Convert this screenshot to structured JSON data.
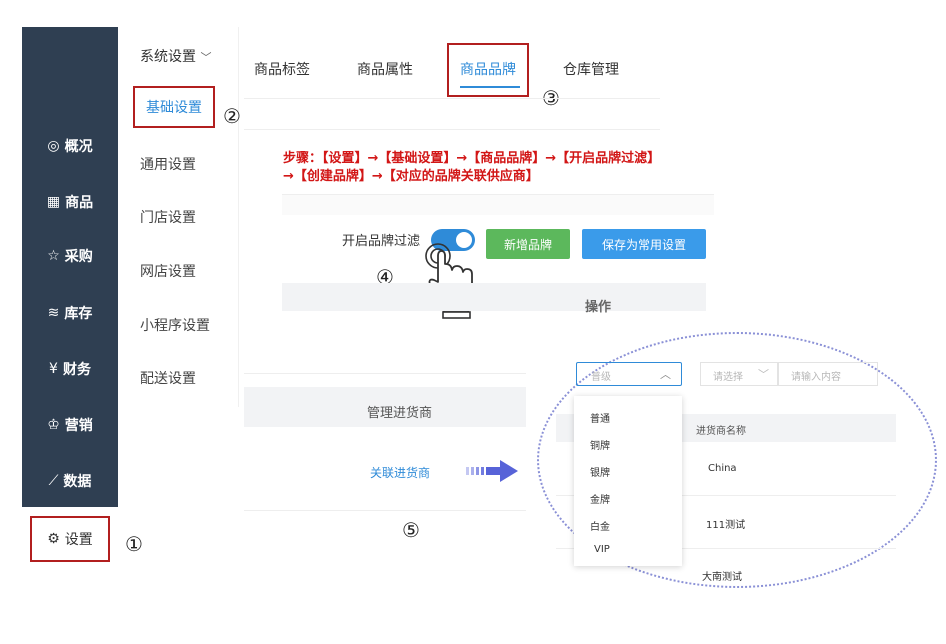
{
  "sidebar": {
    "items": [
      {
        "icon": "compass-icon",
        "glyph": "◎",
        "label": "概况"
      },
      {
        "icon": "grid-icon",
        "glyph": "▦",
        "label": "商品"
      },
      {
        "icon": "cart-icon",
        "glyph": "☆",
        "label": "采购"
      },
      {
        "icon": "layers-icon",
        "glyph": "≋",
        "label": "库存"
      },
      {
        "icon": "yen-icon",
        "glyph": "¥",
        "label": "财务"
      },
      {
        "icon": "crown-icon",
        "glyph": "♔",
        "label": "营销"
      },
      {
        "icon": "chart-icon",
        "glyph": "⟋",
        "label": "数据"
      }
    ],
    "settings": {
      "glyph": "⚙",
      "label": "设置"
    }
  },
  "submenu": {
    "header": "系统设置",
    "items": [
      "基础设置",
      "通用设置",
      "门店设置",
      "网店设置",
      "小程序设置",
      "配送设置"
    ]
  },
  "tabs": [
    "商品标签",
    "商品属性",
    "商品品牌",
    "仓库管理"
  ],
  "steps": {
    "line1": "步骤：【设置】→【基础设置】→【商品品牌】→【开启品牌过滤】",
    "line2": "→【创建品牌】→【对应的品牌关联供应商】"
  },
  "markers": {
    "m1": "①",
    "m2": "②",
    "m3": "③",
    "m4": "④",
    "m5": "⑤"
  },
  "brand_filter": {
    "label": "开启品牌过滤",
    "enabled": true
  },
  "buttons": {
    "new_brand": "新增品牌",
    "save_default": "保存为常用设置"
  },
  "table": {
    "operation_header": "操作",
    "supplier_header": "管理进货商",
    "link_supplier": "关联进货商"
  },
  "zoom_panel": {
    "select_text": "普级",
    "select_placeholder": "请选择",
    "input_placeholder": "请输入内容",
    "dropdown_options": [
      "普通",
      "铜牌",
      "银牌",
      "金牌",
      "白金",
      "VIP"
    ],
    "column_header": "进货商名称",
    "rows": [
      "China",
      "111测试",
      "大南测试"
    ]
  },
  "colors": {
    "sidebar": "#2f3f52",
    "accent": "#2f8bd8",
    "annotation_red": "#b21f1f",
    "green_button": "#5cb85c",
    "blue_button": "#3a9bea"
  }
}
